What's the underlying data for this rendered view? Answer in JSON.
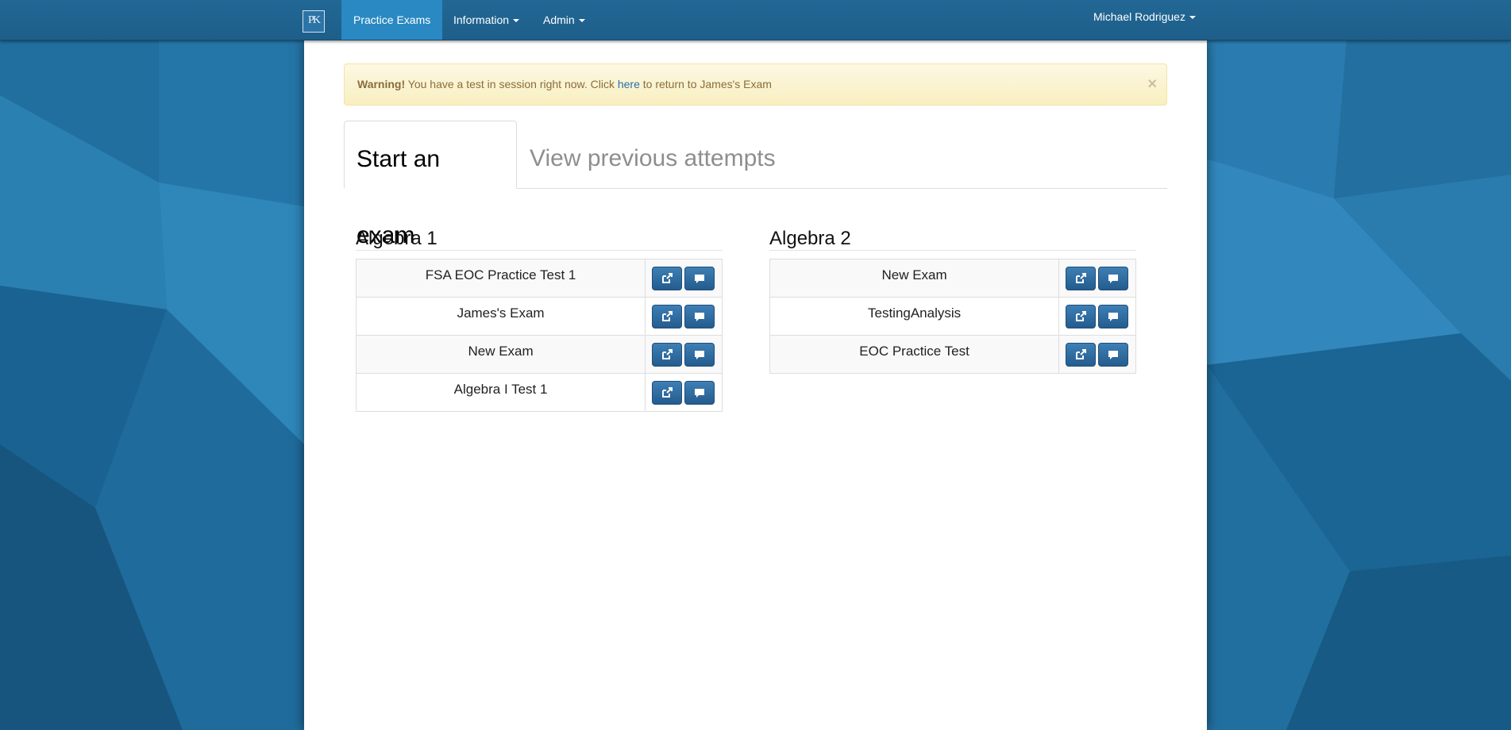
{
  "navbar": {
    "logo_text": "PK",
    "items": [
      {
        "label": "Practice Exams",
        "active": true
      },
      {
        "label": "Information",
        "dropdown": true
      },
      {
        "label": "Admin",
        "dropdown": true
      }
    ],
    "user": {
      "label": "Michael Rodriguez",
      "dropdown": true
    }
  },
  "alert": {
    "strong": "Warning!",
    "text_before": " You have a test in session right now. Click ",
    "link": "here",
    "text_after": " to return to James's Exam",
    "close": "×"
  },
  "tabs": [
    {
      "label": "Start an exam",
      "active": true
    },
    {
      "label": "View previous attempts",
      "active": false
    }
  ],
  "courses": [
    {
      "title": "Algebra 1",
      "exams": [
        "FSA EOC Practice Test 1",
        "James's Exam",
        "New Exam",
        "Algebra I Test 1"
      ]
    },
    {
      "title": "Algebra 2",
      "exams": [
        "New Exam",
        "TestingAnalysis",
        "EOC Practice Test"
      ]
    }
  ],
  "icons": {
    "row_open": "external-link-icon",
    "row_comment": "comment-icon"
  },
  "colors": {
    "navbar": "#1e6391",
    "nav_active": "#2a89c2",
    "button": "#2c6699",
    "alert_bg": "#fcf8e3",
    "alert_text": "#8a6d3b"
  }
}
